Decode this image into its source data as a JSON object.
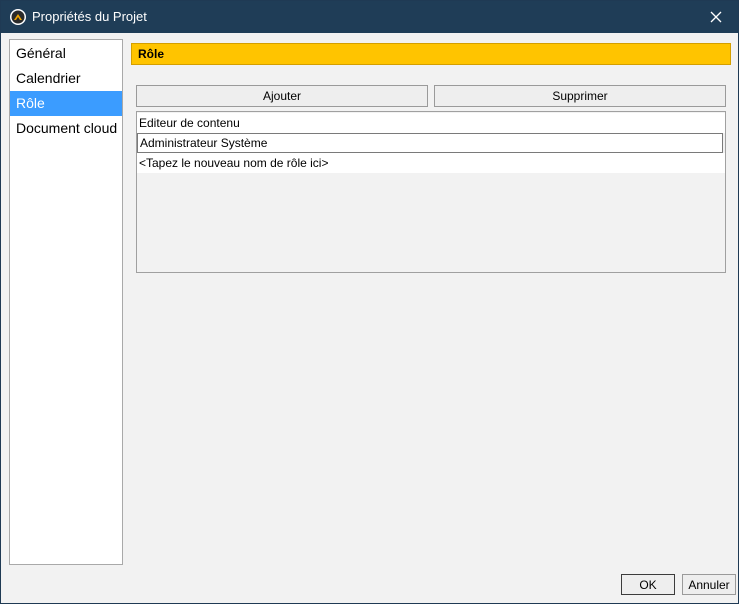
{
  "window": {
    "title": "Propriétés du Projet",
    "app_icon": "project-app-icon",
    "close_icon": "close-icon"
  },
  "nav": {
    "items": [
      {
        "label": "Général",
        "selected": false
      },
      {
        "label": "Calendrier",
        "selected": false
      },
      {
        "label": "Rôle",
        "selected": true
      },
      {
        "label": "Document cloud",
        "selected": false
      }
    ]
  },
  "section": {
    "header": "Rôle",
    "header_color": "#ffc400",
    "add_label": "Ajouter",
    "remove_label": "Supprimer",
    "roles": [
      "Editeur de contenu",
      "Administrateur Système",
      "<Tapez le nouveau nom de rôle ici>"
    ]
  },
  "footer": {
    "ok_label": "OK",
    "cancel_label": "Annuler"
  },
  "colors": {
    "titlebar": "#1f3d57",
    "selection": "#3b9cff"
  }
}
